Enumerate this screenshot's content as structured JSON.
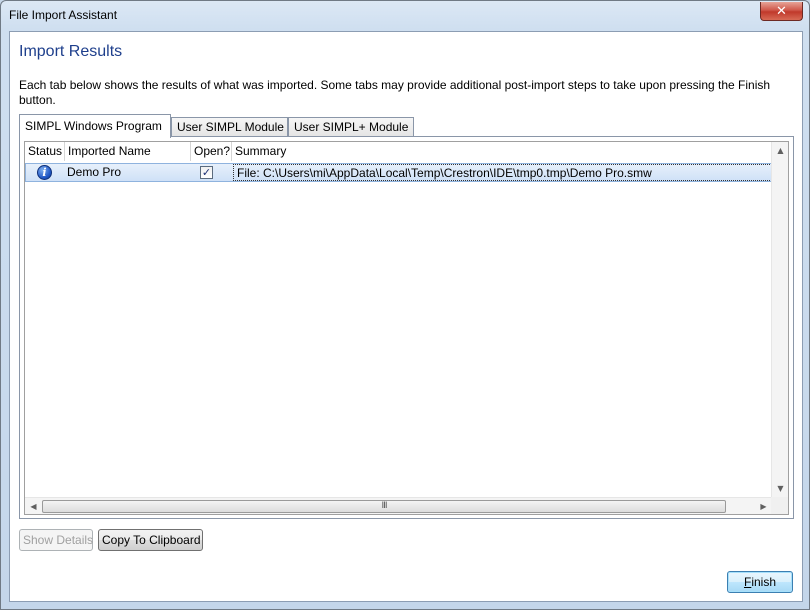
{
  "window": {
    "title": "File Import Assistant",
    "close_symbol": "✕"
  },
  "heading": "Import Results",
  "description": "Each tab below shows the results of what was imported.  Some tabs may provide additional post-import steps to take upon pressing the Finish button.",
  "tabs": [
    {
      "label": "SIMPL Windows Program",
      "active": true
    },
    {
      "label": "User SIMPL Module",
      "active": false
    },
    {
      "label": "User SIMPL+ Module",
      "active": false
    }
  ],
  "grid": {
    "columns": [
      "Status",
      "Imported Name",
      "Open?",
      "Summary"
    ],
    "rows": [
      {
        "status_icon": "info-icon",
        "status_glyph": "i",
        "name": "Demo Pro",
        "open": true,
        "open_glyph": "✓",
        "summary": "File: C:\\Users\\mi\\AppData\\Local\\Temp\\Crestron\\IDE\\tmp0.tmp\\Demo Pro.smw"
      }
    ],
    "scroll_thumb_grip": "III",
    "arrow_up": "▲",
    "arrow_down": "▼",
    "arrow_left": "◀",
    "arrow_right": "▶"
  },
  "buttons": {
    "show_details": "Show Details",
    "copy_clipboard": "Copy To Clipboard",
    "finish_first": "F",
    "finish_rest": "inish"
  }
}
